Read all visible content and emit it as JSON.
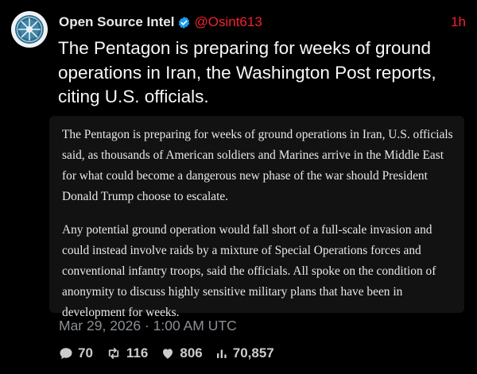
{
  "author": {
    "name": "Open Source Intel",
    "handle": "@Osint613",
    "time_ago": "1h",
    "avatar_icon": "compass-emblem-icon",
    "verified_icon": "verified-badge-icon"
  },
  "tweet": {
    "text": "The Pentagon is preparing for weeks of ground operations in Iran, the Washington Post reports, citing U.S. officials."
  },
  "quote": {
    "paragraphs": [
      "The Pentagon is preparing for weeks of ground operations in Iran, U.S. officials said, as thousands of American soldiers and Marines arrive in the Middle East for what could become a dangerous new phase of the war should President Donald Trump choose to escalate.",
      "Any potential ground operation would fall short of a full-scale invasion and could instead involve raids by a mixture of Special Operations forces and conventional infantry troops, said the officials. All spoke on the condition of anonymity to discuss highly sensitive military plans that have been in development for weeks."
    ]
  },
  "meta": {
    "timestamp": "Mar 29, 2026 · 1:00 AM UTC"
  },
  "stats": {
    "replies": "70",
    "reposts": "116",
    "likes": "806",
    "views": "70,857"
  },
  "colors": {
    "background": "#000000",
    "accent": "#f4212e",
    "verified": "#1d9bf0",
    "muted": "#8b8f94"
  }
}
